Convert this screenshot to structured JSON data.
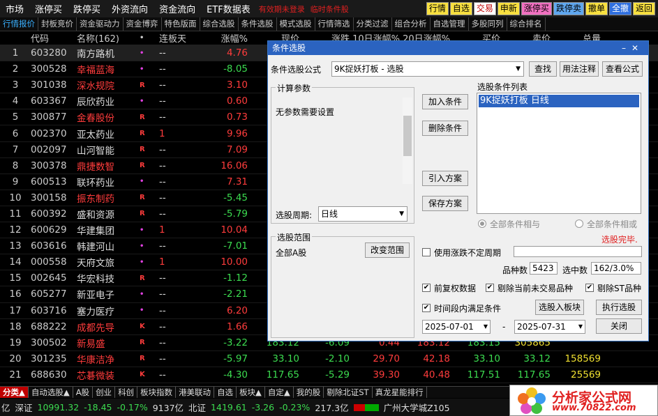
{
  "menu": {
    "items": [
      "市场",
      "涨停买",
      "跌停买",
      "外资流向",
      "资金流向",
      "ETF数据表"
    ],
    "warn1": "有效期未登录",
    "warn2": "临时条件股",
    "quick_buttons": [
      {
        "label": "行情",
        "bg": "#f8e040",
        "fg": "#000"
      },
      {
        "label": "自选",
        "bg": "#f8e040",
        "fg": "#000"
      },
      {
        "label": "交易",
        "bg": "#ffffff",
        "fg": "#c00000"
      },
      {
        "label": "申新",
        "bg": "#f8e040",
        "fg": "#000"
      },
      {
        "label": "涨停买",
        "bg": "#f070c0",
        "fg": "#000"
      },
      {
        "label": "跌停卖",
        "bg": "#60a8f0",
        "fg": "#000"
      },
      {
        "label": "撤单",
        "bg": "#f8e040",
        "fg": "#000"
      },
      {
        "label": "全撤",
        "bg": "#3070e0",
        "fg": "#fff"
      },
      {
        "label": "返回",
        "bg": "#f8e040",
        "fg": "#000"
      }
    ]
  },
  "tabs": [
    "行情报价",
    "封板竞价",
    "资金驱动力",
    "资金博弈",
    "特色版面",
    "综合选股",
    "条件选股",
    "模式选股",
    "行情筛选",
    "分类过滤",
    "组合分析",
    "自选管理",
    "多股同列",
    "综合排名"
  ],
  "table": {
    "headers": [
      "",
      "代码",
      "名称(162)",
      "•",
      "连板天",
      "涨幅%",
      "现价",
      "涨跌",
      "10日涨幅%",
      "20日涨幅%",
      "买价",
      "卖价",
      "总量"
    ],
    "rows": [
      {
        "n": "1",
        "code": "603280",
        "name": "南方路机",
        "flag": "•",
        "lb": "--",
        "pct": "4.76",
        "sel": true
      },
      {
        "n": "2",
        "code": "300528",
        "name": "幸福蓝海",
        "flag": "•",
        "lb": "--",
        "pct": "-8.05"
      },
      {
        "n": "3",
        "code": "301038",
        "name": "深水规院",
        "flag": "R",
        "lb": "--",
        "pct": "3.10"
      },
      {
        "n": "4",
        "code": "603367",
        "name": "辰欣药业",
        "flag": "•",
        "lb": "--",
        "pct": "0.60"
      },
      {
        "n": "5",
        "code": "300877",
        "name": "金春股份",
        "flag": "R",
        "lb": "--",
        "pct": "0.73"
      },
      {
        "n": "6",
        "code": "002370",
        "name": "亚太药业",
        "flag": "R",
        "lb": "1",
        "pct": "9.96"
      },
      {
        "n": "7",
        "code": "002097",
        "name": "山河智能",
        "flag": "R",
        "lb": "--",
        "pct": "7.09"
      },
      {
        "n": "8",
        "code": "300378",
        "name": "鼎捷数智",
        "flag": "R",
        "lb": "--",
        "pct": "16.06"
      },
      {
        "n": "9",
        "code": "600513",
        "name": "联环药业",
        "flag": "•",
        "lb": "--",
        "pct": "7.31"
      },
      {
        "n": "10",
        "code": "300158",
        "name": "振东制药",
        "flag": "R",
        "lb": "--",
        "pct": "-5.45"
      },
      {
        "n": "11",
        "code": "600392",
        "name": "盛和资源",
        "flag": "R",
        "lb": "--",
        "pct": "-5.79"
      },
      {
        "n": "12",
        "code": "600629",
        "name": "华建集团",
        "flag": "•",
        "lb": "1",
        "pct": "10.04"
      },
      {
        "n": "13",
        "code": "603616",
        "name": "韩建河山",
        "flag": "•",
        "lb": "--",
        "pct": "-7.01"
      },
      {
        "n": "14",
        "code": "000558",
        "name": "天府文旅",
        "flag": "•",
        "lb": "1",
        "pct": "10.00"
      },
      {
        "n": "15",
        "code": "002645",
        "name": "华宏科技",
        "flag": "R",
        "lb": "--",
        "pct": "-1.12"
      },
      {
        "n": "16",
        "code": "605277",
        "name": "新亚电子",
        "flag": "•",
        "lb": "--",
        "pct": "-2.21"
      },
      {
        "n": "17",
        "code": "603716",
        "name": "塞力医疗",
        "flag": "•",
        "lb": "--",
        "pct": "6.20"
      },
      {
        "n": "18",
        "code": "688222",
        "name": "成都先导",
        "flag": "K",
        "lb": "--",
        "pct": "1.66"
      },
      {
        "n": "19",
        "code": "300502",
        "name": "新易盛",
        "flag": "R",
        "lb": "--",
        "pct": "-3.22",
        "rest": [
          "183.12",
          "-6.09",
          "0.44",
          "183.12",
          "183.15",
          "305865"
        ]
      },
      {
        "n": "20",
        "code": "301235",
        "name": "华康洁净",
        "flag": "R",
        "lb": "--",
        "pct": "-5.97",
        "rest": [
          "33.10",
          "-2.10",
          "29.70",
          "42.18",
          "33.10",
          "33.12",
          "158569"
        ]
      },
      {
        "n": "21",
        "code": "688630",
        "name": "芯碁微装",
        "flag": "K",
        "lb": "--",
        "pct": "-4.30",
        "rest": [
          "117.65",
          "-5.29",
          "39.30",
          "40.48",
          "117.51",
          "117.65",
          "25569"
        ]
      }
    ]
  },
  "bottom_tabs": [
    "分类▲",
    "自动选股▲",
    "A股",
    "创业",
    "科创",
    "板块指数",
    "港美联动",
    "自选",
    "板块▲",
    "自定▲",
    "我的股",
    "剔除北证ST",
    "真龙星能排行"
  ],
  "status": {
    "a": "亿",
    "sz_label": "深证",
    "sz_val": "10991.32",
    "sz_chg": "-18.45",
    "sz_pct": "-0.17%",
    "sz_amt": "9137亿",
    "bz_label": "北证",
    "bz_val": "1419.61",
    "bz_chg": "-3.26",
    "bz_pct": "-0.23%",
    "bz_amt": "217.3亿",
    "loc": "广州大学城Z105"
  },
  "logo": {
    "title": "分析家公式网",
    "url": "www.70822.com"
  },
  "dialog": {
    "title": "条件选股",
    "formula_label": "条件选股公式",
    "formula_value": "9K捉妖打板  -  选股",
    "find": "查找",
    "usage": "用法注释",
    "view": "查看公式",
    "params_title": "计算参数",
    "params_text": "无参数需要设置",
    "period_label": "选股周期:",
    "period_value": "日线",
    "add": "加入条件",
    "del": "删除条件",
    "import": "引入方案",
    "save": "保存方案",
    "list_title": "选股条件列表",
    "list_item": "9K捉妖打板  日线",
    "radio_and": "全部条件相与",
    "radio_or": "全部条件相或",
    "done": "选股完毕.",
    "range_title": "选股范围",
    "range_value": "全部A股",
    "range_btn": "改变范围",
    "var_period": "使用涨跌不定周期",
    "count_label": "品种数",
    "count": "5423",
    "hit_label": "选中数",
    "hit": "162/3.0%",
    "c1": "前复权数据",
    "c2": "剔除当前未交易品种",
    "c3": "剔除ST品种",
    "c4": "时间段内满足条件",
    "to_board": "选股入板块",
    "exec": "执行选股",
    "date_from": "2025-07-01",
    "dash": "-",
    "date_to": "2025-07-31",
    "close": "关闭"
  }
}
